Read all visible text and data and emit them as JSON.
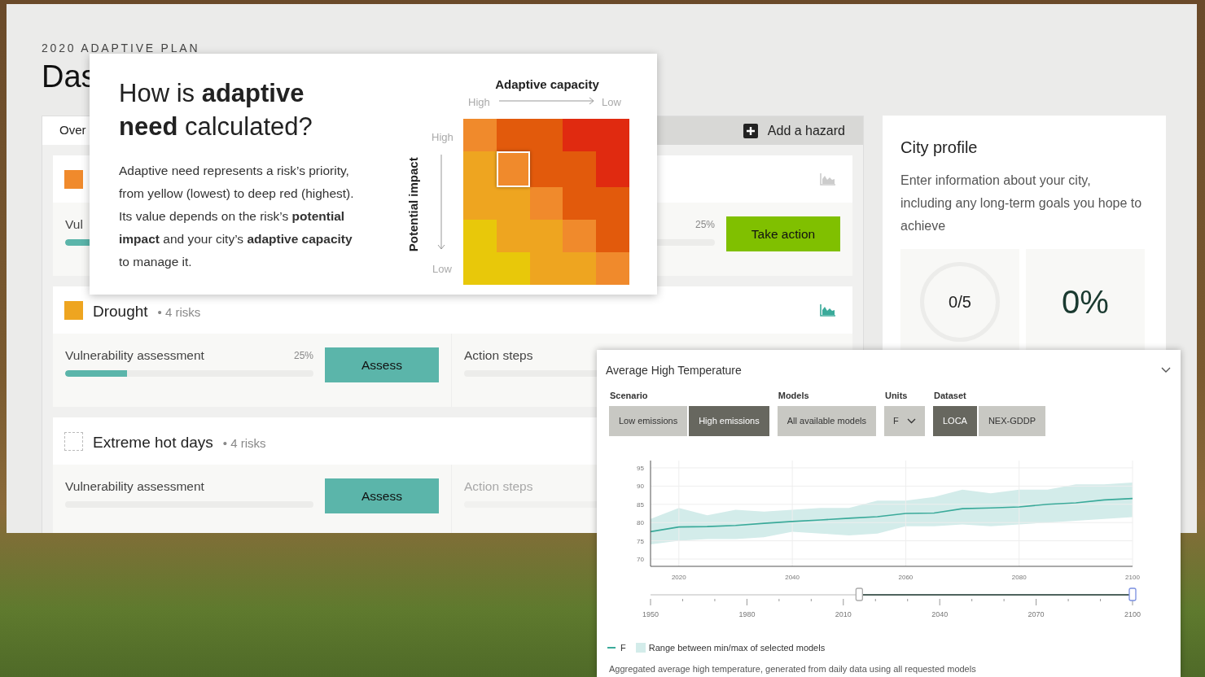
{
  "plan_label": "2020 ADAPTIVE PLAN",
  "page_title": "Das",
  "tabs": [
    {
      "label": "Over",
      "selected": true
    }
  ],
  "add_hazard": "Add a hazard",
  "hazards": [
    {
      "color": "#f08a2c",
      "chart_active": false,
      "vulnerability": {
        "label": "Vul",
        "level": 0.25
      },
      "action": {
        "percent": "25%",
        "button": "Take action",
        "kind": "action"
      }
    },
    {
      "color": "#eea520",
      "title": "Drought",
      "risks": "• 4 risks",
      "chart_active": true,
      "vulnerability": {
        "label": "Vulnerability assessment",
        "percent": "25%",
        "level": 0.25,
        "button": "Assess",
        "kind": "assess"
      },
      "action": {
        "label": "Action steps",
        "disabled": false
      }
    },
    {
      "title": "Extreme hot days",
      "risks": "• 4 risks",
      "vulnerability": {
        "label": "Vulnerability assessment",
        "button": "Assess",
        "kind": "assess"
      },
      "action": {
        "label": "Action steps",
        "disabled": true
      }
    }
  ],
  "city_profile": {
    "title": "City profile",
    "text": "Enter information about your city, including any long-term goals you hope to achieve",
    "stats": [
      {
        "kind": "ring",
        "value": "0/5"
      },
      {
        "kind": "percent",
        "value": "0%"
      }
    ]
  },
  "popup": {
    "heading": "How is **adaptive need** calculated?",
    "body": "Adaptive need represents a risk’s priority, from yellow (lowest) to deep red (highest). Its value depends on the risk’s **potential impact** and your city’s **adaptive capacity** to manage it.",
    "matrix": {
      "title": "Adaptive capacity",
      "x_high": "High",
      "x_low": "Low",
      "y_label": "Potential impact",
      "y_high": "High",
      "y_low": "Low",
      "rows": [
        {
          "cells": [
            {
              "color": "#f08a2c",
              "selected": false
            },
            {
              "color": "#e25a0c",
              "selected": false
            },
            {
              "color": "#e25a0c",
              "selected": false
            },
            {
              "color": "#e02a10",
              "selected": false
            },
            {
              "color": "#e02a10",
              "selected": false
            }
          ]
        },
        {
          "cells": [
            {
              "color": "#eea520",
              "selected": false
            },
            {
              "color": "#f08a2c",
              "selected": true
            },
            {
              "color": "#e25a0c",
              "selected": false
            },
            {
              "color": "#e25a0c",
              "selected": false
            },
            {
              "color": "#e02a10",
              "selected": false
            }
          ]
        },
        {
          "cells": [
            {
              "color": "#eea520",
              "selected": false
            },
            {
              "color": "#eea520",
              "selected": false
            },
            {
              "color": "#f08a2c",
              "selected": false
            },
            {
              "color": "#e25a0c",
              "selected": false
            },
            {
              "color": "#e25a0c",
              "selected": false
            }
          ]
        },
        {
          "cells": [
            {
              "color": "#e8c80a",
              "selected": false
            },
            {
              "color": "#eea520",
              "selected": false
            },
            {
              "color": "#eea520",
              "selected": false
            },
            {
              "color": "#f08a2c",
              "selected": false
            },
            {
              "color": "#e25a0c",
              "selected": false
            }
          ]
        },
        {
          "cells": [
            {
              "color": "#e8c80a",
              "selected": false
            },
            {
              "color": "#e8c80a",
              "selected": false
            },
            {
              "color": "#eea520",
              "selected": false
            },
            {
              "color": "#eea520",
              "selected": false
            },
            {
              "color": "#f08a2c",
              "selected": false
            }
          ]
        }
      ]
    }
  },
  "chart_panel": {
    "title": "Average High Temperature",
    "groups": [
      {
        "label": "Scenario",
        "kind": "toggle",
        "options": [
          {
            "label": "Low emissions",
            "selected": false
          },
          {
            "label": "High emissions",
            "selected": true
          }
        ]
      },
      {
        "label": "Models",
        "kind": "toggle",
        "options": [
          {
            "label": "All available models",
            "selected": false
          }
        ]
      },
      {
        "label": "Units",
        "kind": "dropdown",
        "value": "F"
      },
      {
        "label": "Dataset",
        "kind": "toggle",
        "options": [
          {
            "label": "LOCA",
            "selected": true
          },
          {
            "label": "NEX-GDDP",
            "selected": false
          }
        ]
      }
    ],
    "chart_data": {
      "type": "line",
      "x": [
        2015,
        2020,
        2025,
        2030,
        2035,
        2040,
        2045,
        2050,
        2055,
        2060,
        2065,
        2070,
        2075,
        2080,
        2085,
        2090,
        2095,
        2100
      ],
      "xlim": [
        2015,
        2100
      ],
      "ylim": [
        68,
        97
      ],
      "xticks": [
        2020,
        2040,
        2060,
        2080,
        2100
      ],
      "yticks": [
        70,
        75,
        80,
        85,
        90,
        95
      ],
      "series": [
        {
          "name": "F",
          "color": "#3aaa9a",
          "values": [
            77.5,
            78.8,
            78.9,
            79.2,
            79.8,
            80.3,
            80.7,
            81.2,
            81.6,
            82.5,
            82.6,
            83.8,
            84,
            84.3,
            85,
            85.4,
            86.2,
            86.6
          ]
        },
        {
          "name": "Range between min/max of selected models",
          "type": "area",
          "color": "#d3ecea",
          "values": [
            81,
            84,
            82,
            83.5,
            83,
            83.5,
            84,
            84,
            86,
            86,
            87,
            89,
            88,
            89,
            89,
            90.5,
            90.5,
            91
          ]
        },
        {
          "type": "area",
          "color": "#ffffff",
          "values": [
            74,
            75,
            75.5,
            75.5,
            76,
            77.5,
            77,
            76.5,
            77,
            79,
            79,
            79.5,
            79,
            79.5,
            80,
            80.5,
            81,
            81.5
          ]
        }
      ],
      "grid": true
    },
    "range_slider": {
      "labels": [
        "1950",
        "1980",
        "2010",
        "2040",
        "2070",
        "2100"
      ],
      "handles": [
        {
          "level": 0.433
        },
        {
          "level": 1
        }
      ]
    },
    "caption": "Aggregated average high temperature, generated from daily data using all requested models"
  }
}
